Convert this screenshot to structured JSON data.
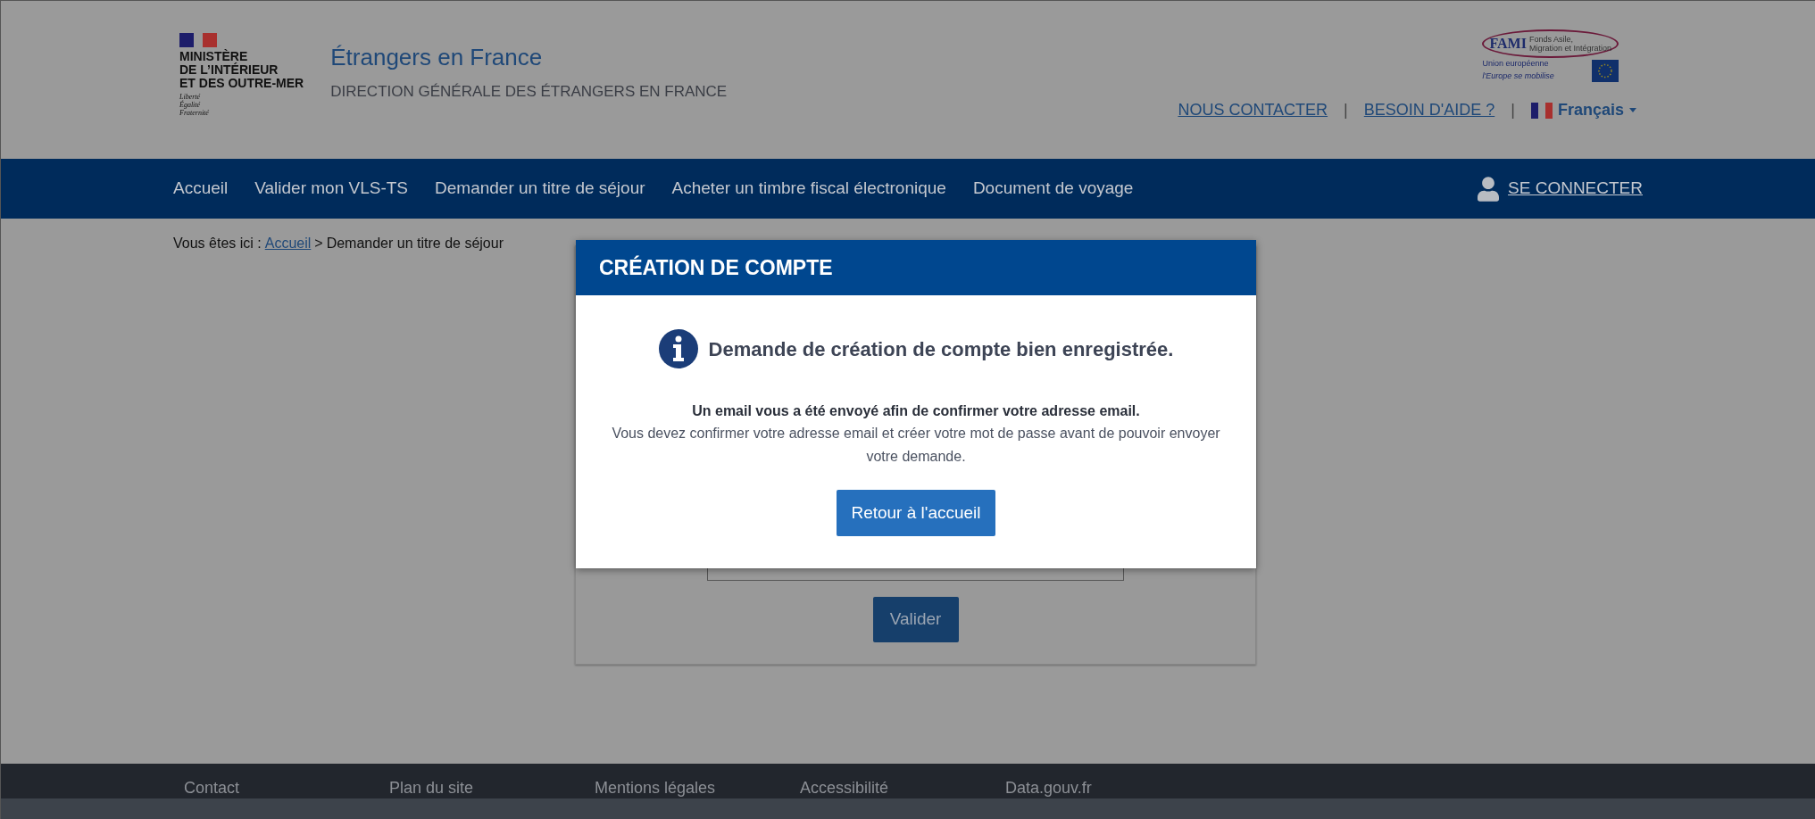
{
  "ministry_logo": {
    "lines": [
      "MINISTÈRE",
      "DE L’INTÉRIEUR",
      "ET DES OUTRE-MER"
    ],
    "motto": [
      "Liberté",
      "Égalité",
      "Fraternité"
    ]
  },
  "site": {
    "title": "Étrangers en France",
    "subtitle": "DIRECTION GÉNÉRALE DES ÉTRANGERS EN FRANCE"
  },
  "partner_logo": {
    "name": "FAMI",
    "lines": [
      "Fonds Asile,",
      "Migration et Intégration"
    ],
    "union": "Union européenne",
    "slogan": "l'Europe se mobilise"
  },
  "top_links": [
    {
      "label": "NOUS CONTACTER"
    },
    {
      "label": "BESOIN D'AIDE ?"
    }
  ],
  "separators": [
    "|",
    "|"
  ],
  "language": {
    "label": "Français"
  },
  "nav": {
    "items": [
      "Accueil",
      "Valider mon VLS-TS",
      "Demander un titre de séjour",
      "Acheter un timbre fiscal électronique",
      "Document de voyage"
    ],
    "login": "SE CONNECTER"
  },
  "breadcrumb": {
    "prefix": "Vous êtes ici :",
    "link": "Accueil",
    "separator": ">",
    "current": "Demander un titre de séjour"
  },
  "form": {
    "button": "Valider"
  },
  "modal": {
    "title": "CRÉATION DE COMPTE",
    "heading": "Demande de création de compte bien enregistrée.",
    "bold_line": "Un email vous a été envoyé afin de confirmer votre adresse email.",
    "text": "Vous devez confirmer votre adresse email et créer votre mot de passe avant de pouvoir envoyer votre demande.",
    "button": "Retour à l'accueil"
  },
  "footer": {
    "links": [
      "Contact",
      "Plan du site",
      "Mentions légales",
      "Accessibilité",
      "Data.gouv.fr"
    ]
  }
}
